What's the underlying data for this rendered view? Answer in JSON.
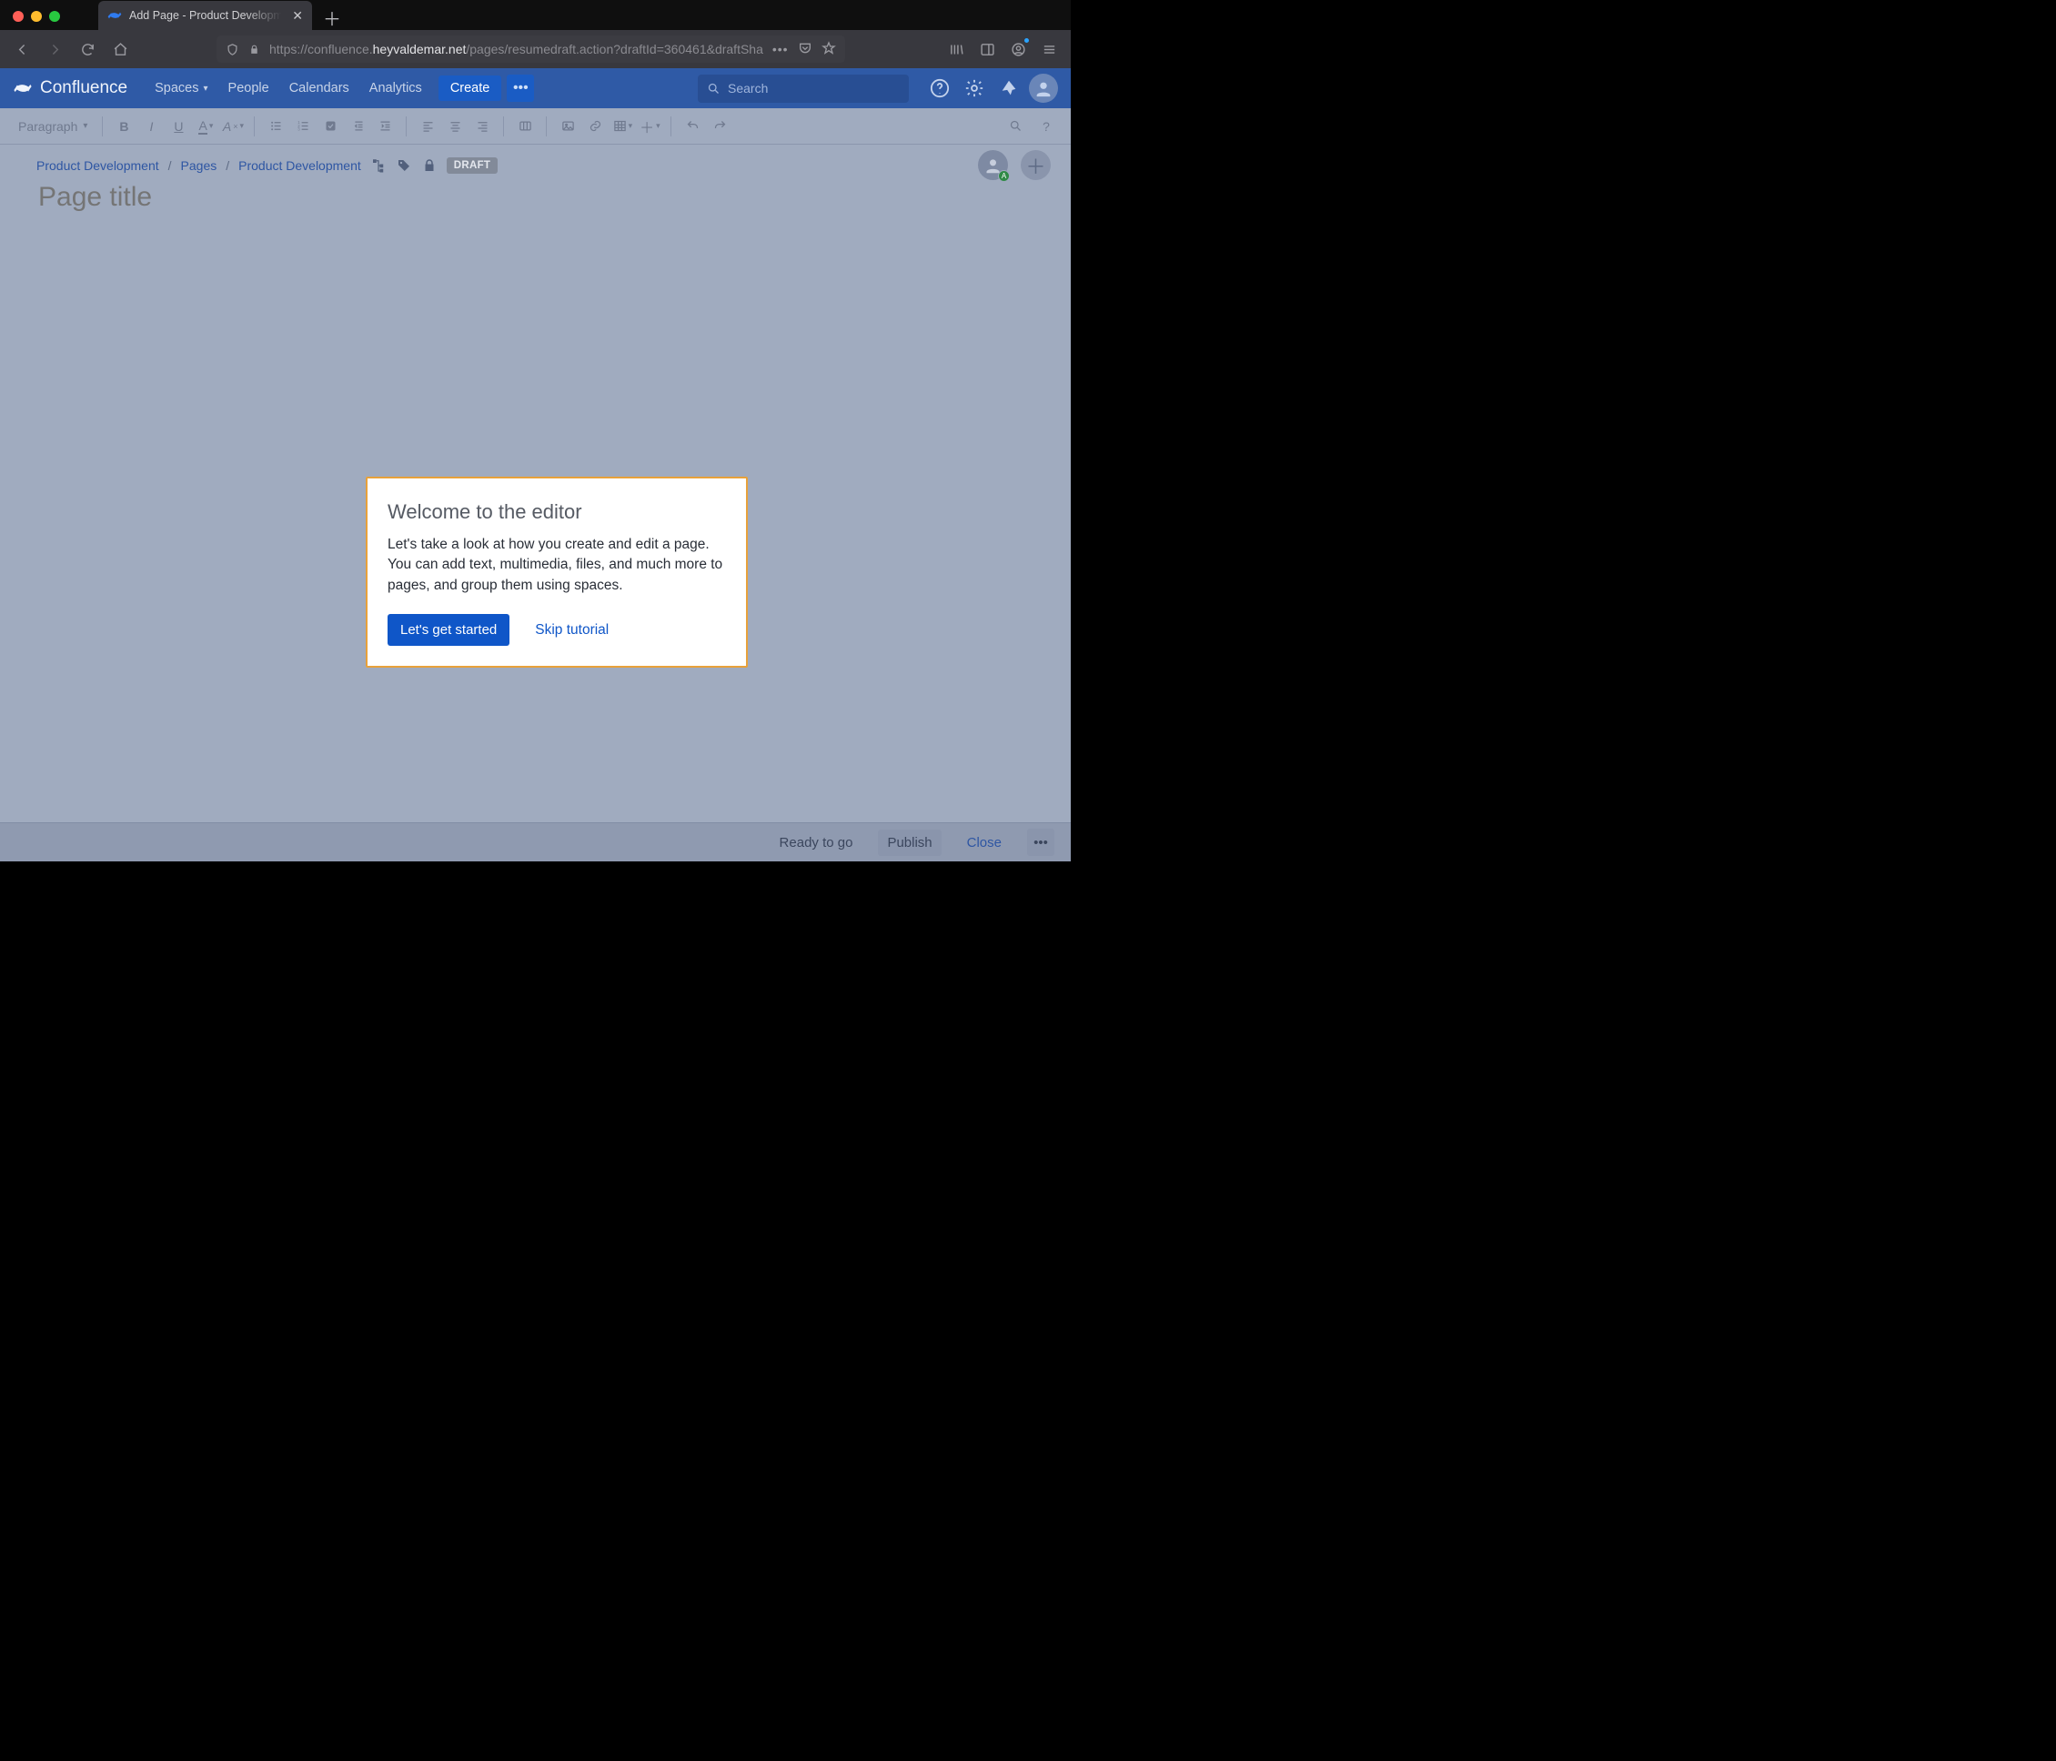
{
  "browser": {
    "tab_title": "Add Page - Product Developme",
    "url_prefix": "https://confluence.",
    "url_host": "heyvaldemar.net",
    "url_path": "/pages/resumedraft.action?draftId=360461&draftSha"
  },
  "nav": {
    "brand": "Confluence",
    "links": [
      "Spaces",
      "People",
      "Calendars",
      "Analytics"
    ],
    "create": "Create",
    "search_placeholder": "Search"
  },
  "toolbar": {
    "paragraph": "Paragraph"
  },
  "breadcrumbs": {
    "items": [
      "Product Development",
      "Pages",
      "Product Development"
    ],
    "draft": "DRAFT"
  },
  "page": {
    "title_placeholder": "Page title",
    "collab_badge": "A"
  },
  "modal": {
    "heading": "Welcome to the editor",
    "body": "Let's take a look at how you create and edit a page. You can add text, multimedia, files, and much more to pages, and group them using spaces.",
    "primary": "Let's get started",
    "skip": "Skip tutorial"
  },
  "bottom": {
    "status": "Ready to go",
    "publish": "Publish",
    "close": "Close"
  }
}
